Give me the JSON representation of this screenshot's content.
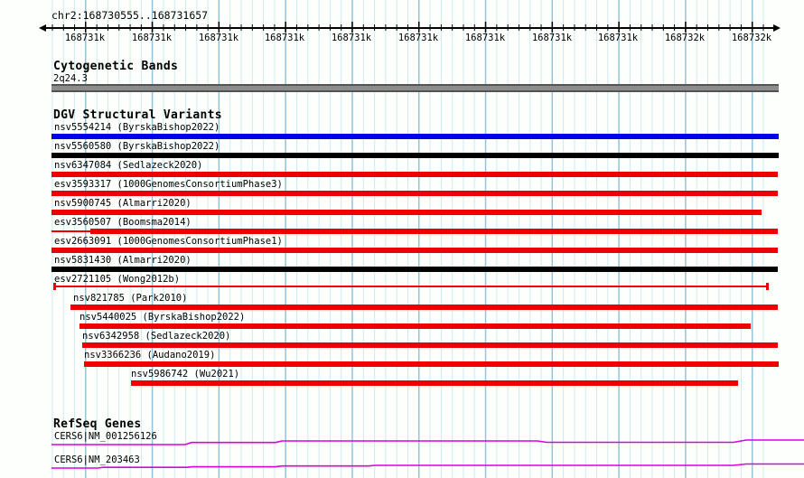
{
  "window": {
    "region_title": "chr2:168730555..168731657"
  },
  "ruler": {
    "tick_labels": [
      "168731k",
      "168731k",
      "168731k",
      "168731k",
      "168731k",
      "168731k",
      "168731k",
      "168731k",
      "168731k",
      "168732k",
      "168732k"
    ]
  },
  "cytobands": {
    "title": "Cytogenetic Bands",
    "band": {
      "name": "2q24.3",
      "color": "#8c8c8c"
    }
  },
  "dgv": {
    "title": "DGV Structural Variants",
    "variants": [
      {
        "id": "nsv5554214",
        "study": "ByrskaBishop2022",
        "label": "nsv5554214 (ByrskaBishop2022)",
        "color": "#0000e8"
      },
      {
        "id": "nsv5560580",
        "study": "ByrskaBishop2022",
        "label": "nsv5560580 (ByrskaBishop2022)",
        "color": "#000000"
      },
      {
        "id": "nsv6347084",
        "study": "Sedlazeck2020",
        "label": "nsv6347084 (Sedlazeck2020)",
        "color": "#ee0000"
      },
      {
        "id": "esv3593317",
        "study": "1000GenomesConsortiumPhase3",
        "label": "esv3593317 (1000GenomesConsortiumPhase3)",
        "color": "#ee0000"
      },
      {
        "id": "nsv5900745",
        "study": "Almarri2020",
        "label": "nsv5900745 (Almarri2020)",
        "color": "#ee0000"
      },
      {
        "id": "esv3560507",
        "study": "Boomsma2014",
        "label": "esv3560507 (Boomsma2014)",
        "color": "#ee0000"
      },
      {
        "id": "esv2663091",
        "study": "1000GenomesConsortiumPhase1",
        "label": "esv2663091 (1000GenomesConsortiumPhase1)",
        "color": "#ee0000"
      },
      {
        "id": "nsv5831430",
        "study": "Almarri2020",
        "label": "nsv5831430 (Almarri2020)",
        "color": "#000000"
      },
      {
        "id": "esv2721105",
        "study": "Wong2012b",
        "label": "esv2721105 (Wong2012b)",
        "color": "#ee0000"
      },
      {
        "id": "nsv821785",
        "study": "Park2010",
        "label": "nsv821785 (Park2010)",
        "color": "#ee0000"
      },
      {
        "id": "nsv5440025",
        "study": "ByrskaBishop2022",
        "label": "nsv5440025 (ByrskaBishop2022)",
        "color": "#ee0000"
      },
      {
        "id": "nsv6342958",
        "study": "Sedlazeck2020",
        "label": "nsv6342958 (Sedlazeck2020)",
        "color": "#ee0000"
      },
      {
        "id": "nsv3366236",
        "study": "Audano2019",
        "label": "nsv3366236 (Audano2019)",
        "color": "#ee0000"
      },
      {
        "id": "nsv5986742",
        "study": "Wu2021",
        "label": "nsv5986742 (Wu2021)",
        "color": "#ee0000"
      }
    ]
  },
  "refseq": {
    "title": "RefSeq Genes",
    "color": "#dd00dd",
    "genes": [
      {
        "label": "CERS6|NM_001256126"
      },
      {
        "label": "CERS6|NM_203463"
      }
    ]
  },
  "colors": {
    "background": "#fcfffc",
    "grid_minor": "#cfeaec",
    "grid_major": "#94c4d8"
  }
}
